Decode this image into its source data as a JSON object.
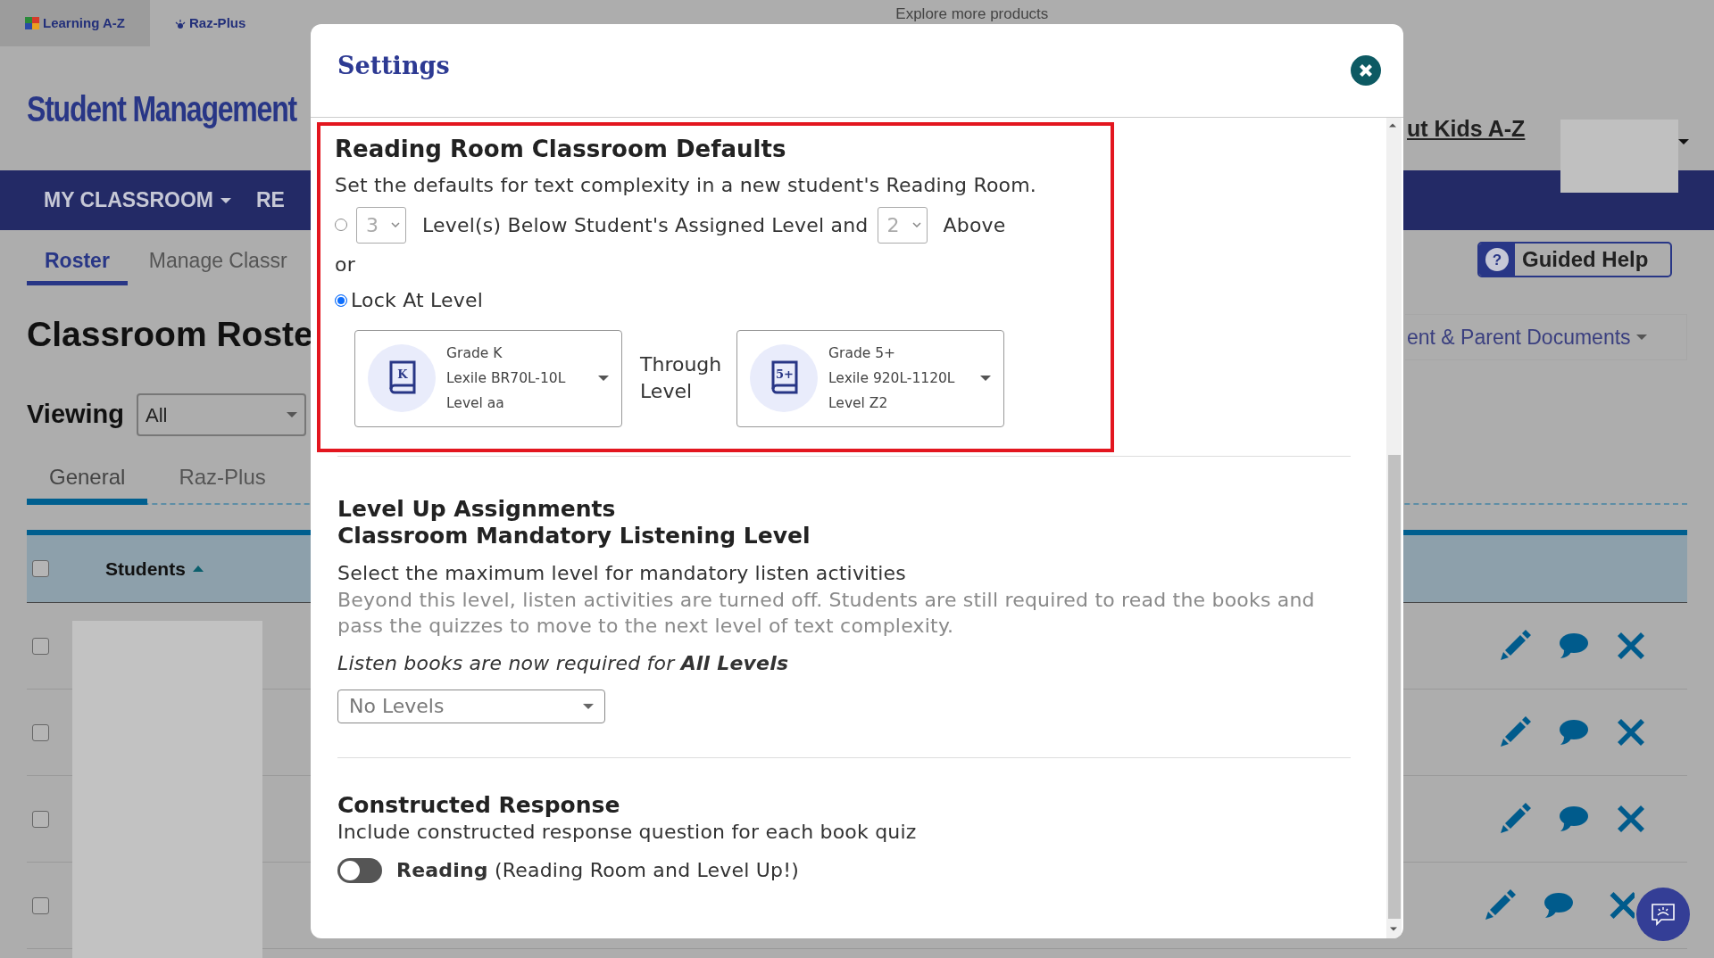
{
  "top_bar": {
    "products": [
      {
        "label": "Learning A-Z",
        "selected": true
      },
      {
        "label": "Raz-Plus",
        "selected": false
      }
    ],
    "explore": "Explore more products"
  },
  "header": {
    "title": "Student Management",
    "about_link": "ut Kids A-Z"
  },
  "nav": [
    {
      "label": "MY CLASSROOM",
      "has_menu": true
    },
    {
      "label": "RE",
      "has_menu": false
    }
  ],
  "subnav": [
    {
      "label": "Roster",
      "selected": true
    },
    {
      "label": "Manage Classr",
      "selected": false
    }
  ],
  "guided_help": {
    "icon": "?",
    "label": "Guided Help"
  },
  "page_title": "Classroom Roste",
  "documents_menu": "ent & Parent Documents",
  "viewing": {
    "label": "Viewing",
    "value": "All"
  },
  "roster_tabs": [
    {
      "label": "General",
      "selected": true
    },
    {
      "label": "Raz-Plus",
      "selected": false
    }
  ],
  "table": {
    "select_all": {
      "checked": false
    },
    "columns": [
      {
        "label": "Students",
        "sorted": true
      }
    ],
    "rows": [
      {
        "checked": false
      },
      {
        "checked": false
      },
      {
        "checked": false
      },
      {
        "checked": false
      }
    ]
  },
  "settings": {
    "title": "Settings",
    "reading_room": {
      "title": "Reading Room Classroom Defaults",
      "description": "Set the defaults for text complexity in a new student's Reading Room.",
      "range": {
        "selected": false,
        "below": "3",
        "text": "Level(s) Below Student's Assigned Level and",
        "above": "2",
        "suffix": "Above"
      },
      "or": "or",
      "lock": {
        "selected": true,
        "label": "Lock At Level"
      },
      "from": {
        "badge": "K",
        "grade": "Grade K",
        "lexile": "Lexile BR70L-10L",
        "level": "Level aa"
      },
      "through": "Through Level",
      "to": {
        "badge": "5+",
        "grade": "Grade 5+",
        "lexile": "Lexile 920L-1120L",
        "level": "Level Z2"
      }
    },
    "level_up": {
      "title": "Level Up Assignments",
      "subtitle": "Classroom Mandatory Listening Level",
      "description": "Select the maximum level for mandatory listen activities",
      "note": "Beyond this level, listen activities are turned off. Students are still required to read the books and pass the quizzes to move to the next level of text complexity.",
      "required": "Listen books are now required for **All Levels**",
      "select": "No Levels"
    },
    "constructed": {
      "title": "Constructed Response",
      "description": "Include constructed response question for each book quiz",
      "toggle": {
        "on": false,
        "label": "**Reading** (Reading Room and Level Up!)"
      }
    }
  }
}
